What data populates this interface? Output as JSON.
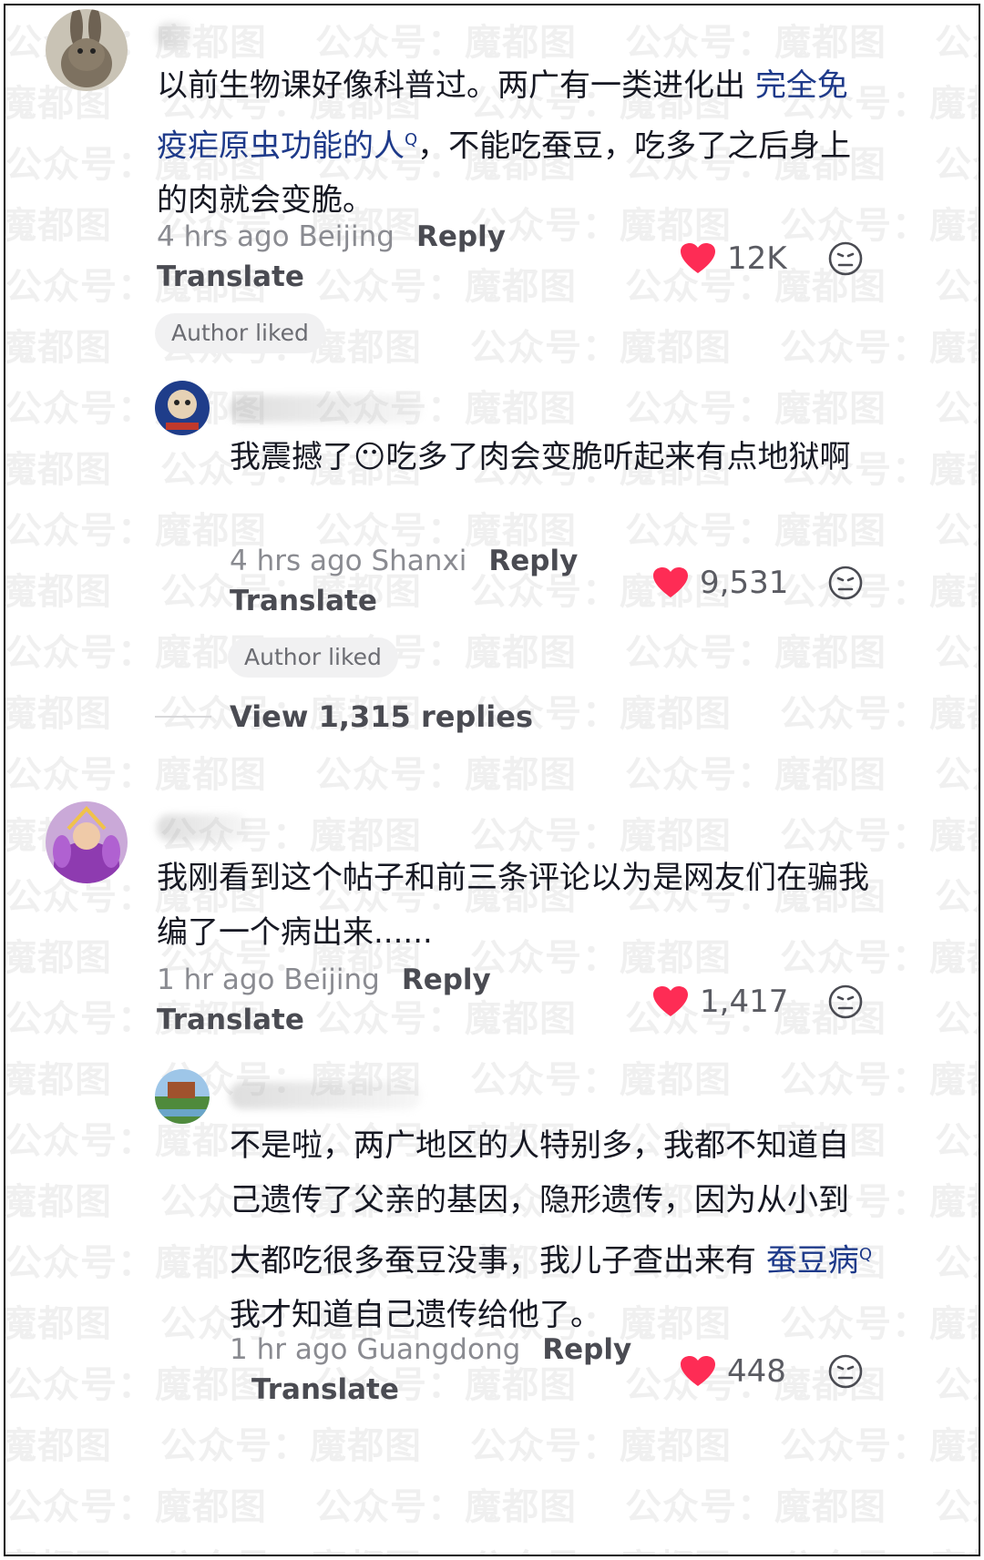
{
  "watermark": "公众号：魔都图",
  "comments": [
    {
      "text_parts": [
        "以前生物课好像科普过。两广有一类进化出 ",
        "完全免疫疟原虫功能的人",
        "，不能吃蚕豆，吃多了之后身上的肉就会变脆。"
      ],
      "time_location": "4 hrs ago Beijing",
      "reply_label": "Reply",
      "translate_label": "Translate",
      "likes": "12K",
      "badge": "Author liked"
    },
    {
      "text": "我震撼了😶吃多了肉会变脆听起来有点地狱啊",
      "time_location": "4 hrs ago Shanxi",
      "reply_label": "Reply",
      "translate_label": "Translate",
      "likes": "9,531",
      "badge": "Author liked"
    },
    {
      "text": "我刚看到这个帖子和前三条评论以为是网友们在骗我编了一个病出来......",
      "time_location": "1 hr ago Beijing",
      "reply_label": "Reply",
      "translate_label": "Translate",
      "likes": "1,417"
    },
    {
      "text_parts": [
        "不是啦，两广地区的人特别多，我都不知道自己遗传了父亲的基因，隐形遗传，因为从小到大都吃很多蚕豆没事，我儿子查出来有 ",
        "蚕豆病",
        " 我才知道自己遗传给他了。"
      ],
      "time_location": "1 hr ago Guangdong",
      "reply_label": "Reply",
      "translate_label": "Translate",
      "likes": "448"
    }
  ],
  "view_replies": "View 1,315 replies",
  "colors": {
    "heart": "#fe2c55",
    "link": "#1e3a8a",
    "meta": "#8a8b91"
  },
  "icons": [
    "heart-icon",
    "dislike-face-icon",
    "search-superscript-icon"
  ]
}
